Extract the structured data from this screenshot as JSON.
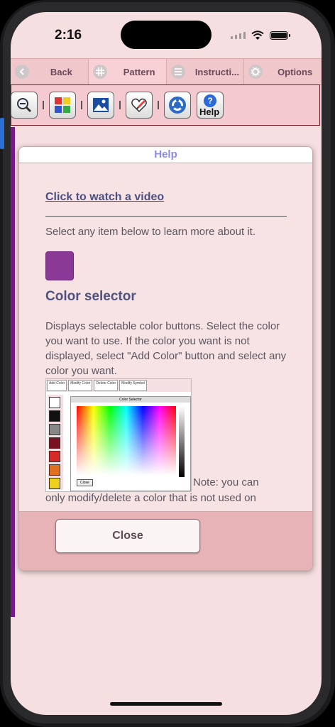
{
  "status_bar": {
    "time": "2:16"
  },
  "nav": {
    "items": [
      {
        "label": "Back",
        "icon": "chevron-left-icon"
      },
      {
        "label": "Pattern",
        "icon": "grid-icon",
        "active": true
      },
      {
        "label": "Instructi...",
        "icon": "list-icon"
      },
      {
        "label": "Options",
        "icon": "gear-icon"
      }
    ]
  },
  "toolbar": {
    "items": [
      "zoom-icon",
      "color-palette-icon",
      "image-icon",
      "heart-pencil-icon",
      "settings-wheel-icon",
      "help-icon"
    ],
    "help_label": "Help"
  },
  "dialog": {
    "title": "Help",
    "video_link": "Click to watch a video",
    "intro": "Select any item below to learn more about it.",
    "swatch_color": "#8a3a96",
    "heading": "Color selector",
    "description": "Displays selectable color buttons. Select the color you want to use. If the color you want is not displayed, select \"Add Color\" button and select any color you want.",
    "note_part1": "Note: you can",
    "note_part2": "only modify/delete a color that is not used on",
    "close_label": "Close",
    "embedded": {
      "buttons": [
        "Add Color",
        "Modify Color",
        "Delete Color",
        "Modify Symbol"
      ],
      "panel_title": "Color Selector",
      "panel_close": "Close"
    }
  }
}
